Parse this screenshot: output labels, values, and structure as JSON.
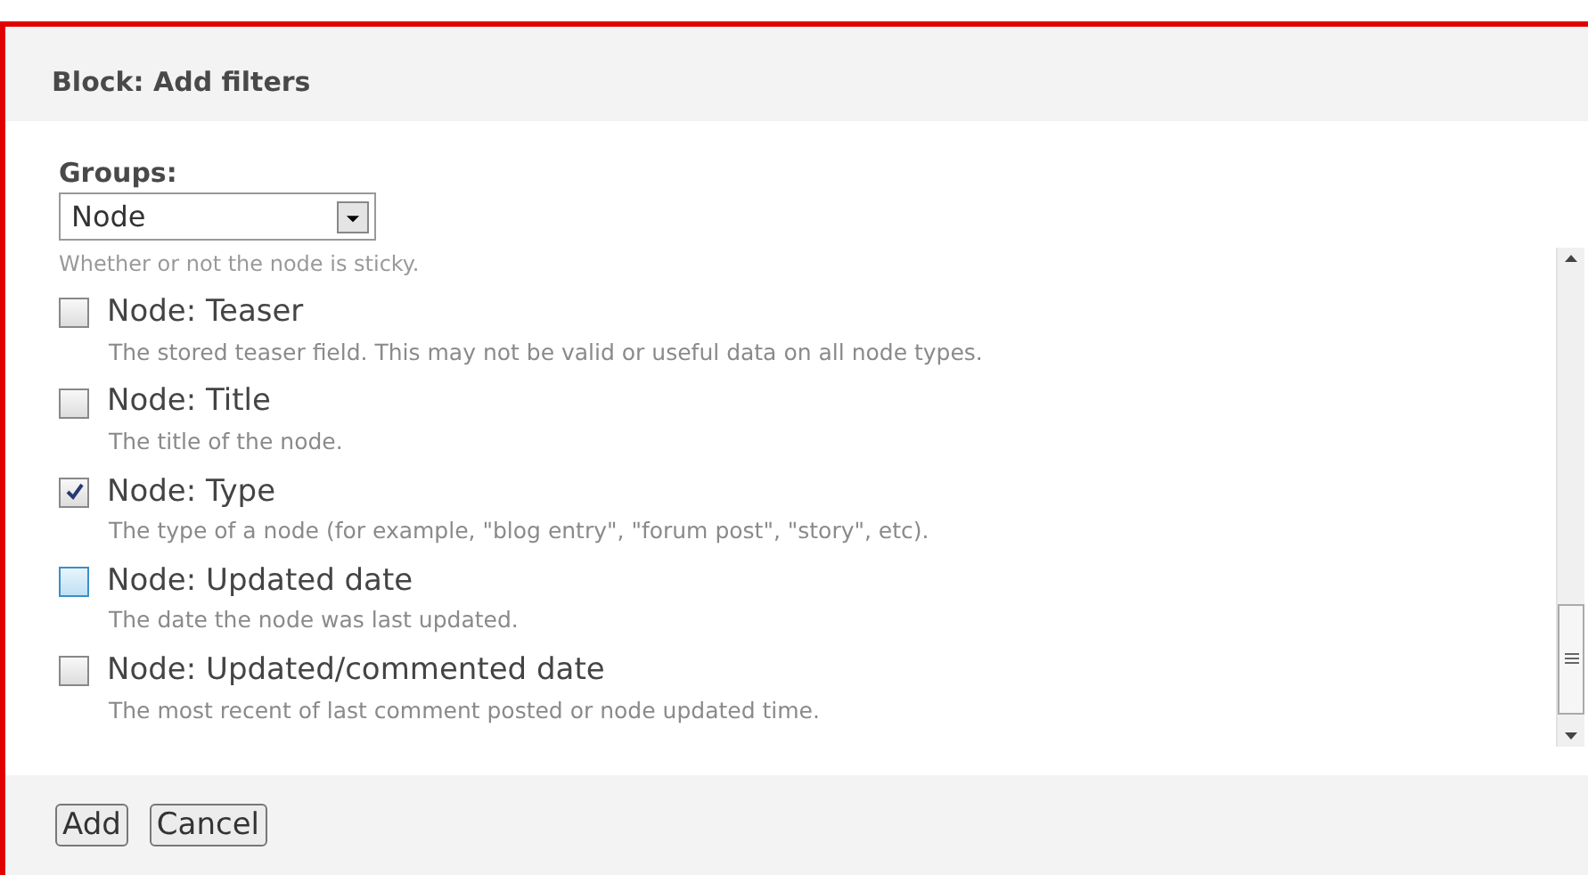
{
  "dialog": {
    "title": "Block: Add filters"
  },
  "groups": {
    "label": "Groups:",
    "value": "Node"
  },
  "items": [
    {
      "kind": "note",
      "description": "Whether or not the node is sticky."
    },
    {
      "kind": "option",
      "label": "Node: Teaser",
      "description": "The stored teaser field. This may not be valid or useful data on all node types.",
      "checked": false,
      "focused": false
    },
    {
      "kind": "option",
      "label": "Node: Title",
      "description": "The title of the node.",
      "checked": false,
      "focused": false
    },
    {
      "kind": "option",
      "label": "Node: Type",
      "description": "The type of a node (for example, \"blog entry\", \"forum post\", \"story\", etc).",
      "checked": true,
      "focused": false
    },
    {
      "kind": "option",
      "label": "Node: Updated date",
      "description": "The date the node was last updated.",
      "checked": false,
      "focused": true
    },
    {
      "kind": "option",
      "label": "Node: Updated/commented date",
      "description": "The most recent of last comment posted or node updated time.",
      "checked": false,
      "focused": false
    }
  ],
  "buttons": [
    "Add",
    "Cancel"
  ]
}
